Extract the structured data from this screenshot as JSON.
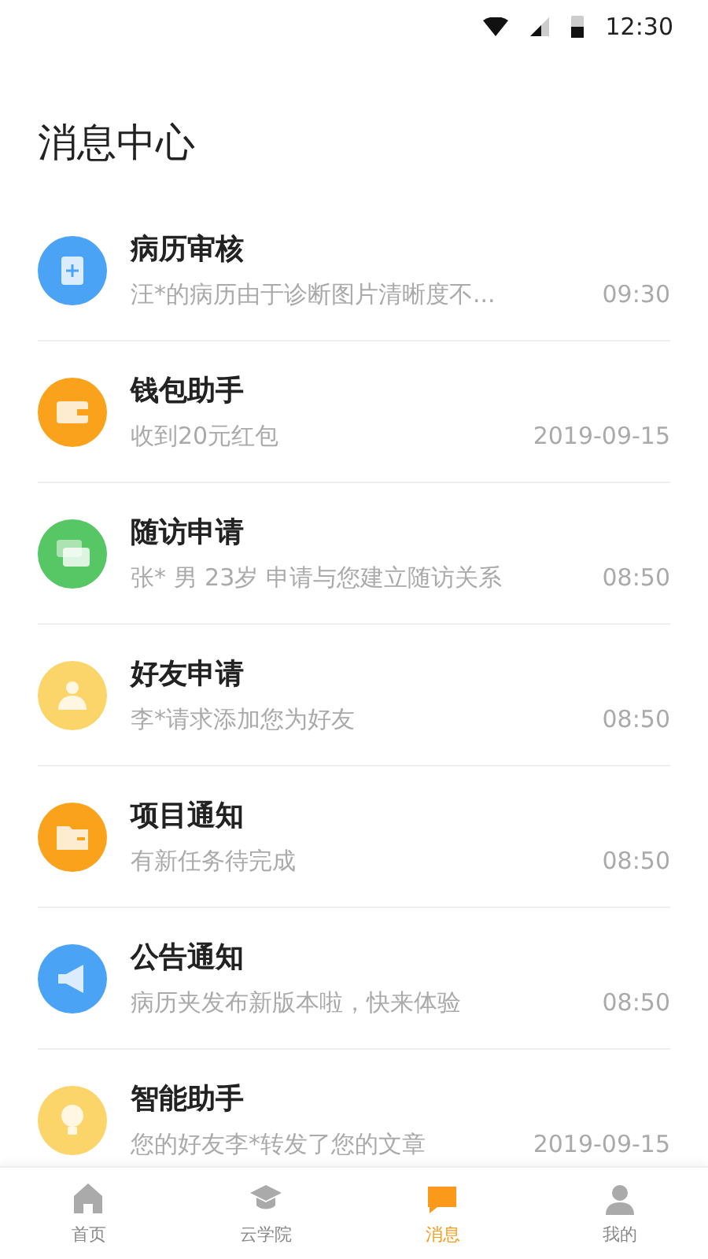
{
  "status_bar": {
    "time": "12:30"
  },
  "title": "消息中心",
  "messages": [
    {
      "kind": "clipboard",
      "color": "#4aa3f5",
      "title": "病历审核",
      "preview": "汪*的病历由于诊断图片清晰度不...",
      "time": "09:30"
    },
    {
      "kind": "wallet",
      "color": "#fba21c",
      "title": "钱包助手",
      "preview": "收到20元红包",
      "time": "2019-09-15"
    },
    {
      "kind": "chat",
      "color": "#57c766",
      "title": "随访申请",
      "preview": "张* 男 23岁 申请与您建立随访关系",
      "time": "08:50"
    },
    {
      "kind": "people",
      "color": "#fcd56a",
      "title": "好友申请",
      "preview": "李*请求添加您为好友",
      "time": "08:50"
    },
    {
      "kind": "folder",
      "color": "#fba21c",
      "title": "项目通知",
      "preview": "有新任务待完成",
      "time": "08:50"
    },
    {
      "kind": "megaphone",
      "color": "#4aa3f5",
      "title": "公告通知",
      "preview": "病历夹发布新版本啦，快来体验",
      "time": "08:50"
    },
    {
      "kind": "bulb",
      "color": "#fcd56a",
      "title": "智能助手",
      "preview": "您的好友李*转发了您的文章",
      "time": "2019-09-15"
    }
  ],
  "tabs": [
    {
      "kind": "home",
      "label": "首页",
      "selected": false
    },
    {
      "kind": "school",
      "label": "云学院",
      "selected": false
    },
    {
      "kind": "message",
      "label": "消息",
      "selected": true
    },
    {
      "kind": "person",
      "label": "我的",
      "selected": false
    }
  ]
}
